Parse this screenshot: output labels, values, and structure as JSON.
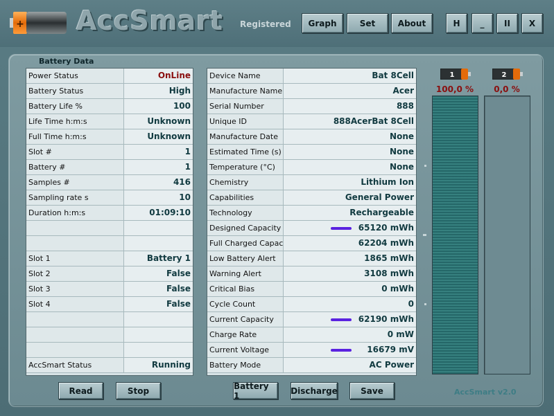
{
  "app": {
    "title": "AccSmart",
    "registered": "Registered",
    "version": "AccSmart v2.0",
    "logo_symbol": "+"
  },
  "header_buttons": {
    "graph": "Graph",
    "set": "Set",
    "about": "About",
    "h": "H",
    "minimize": "_",
    "pause": "II",
    "close": "X"
  },
  "section_label": "Battery Data",
  "left_table": [
    {
      "label": "Power Status",
      "value": "OnLine",
      "red": true
    },
    {
      "label": "Battery Status",
      "value": "High"
    },
    {
      "label": "Battery Life %",
      "value": "100"
    },
    {
      "label": "Life Time h:m:s",
      "value": "Unknown"
    },
    {
      "label": "Full Time h:m:s",
      "value": "Unknown"
    },
    {
      "label": "Slot #",
      "value": "1"
    },
    {
      "label": "Battery #",
      "value": "1"
    },
    {
      "label": "Samples #",
      "value": "416"
    },
    {
      "label": "Sampling rate s",
      "value": "10"
    },
    {
      "label": "Duration h:m:s",
      "value": "01:09:10"
    },
    {
      "label": "",
      "value": ""
    },
    {
      "label": "",
      "value": ""
    },
    {
      "label": "Slot 1",
      "value": "Battery 1"
    },
    {
      "label": "Slot 2",
      "value": "False"
    },
    {
      "label": "Slot 3",
      "value": "False"
    },
    {
      "label": "Slot 4",
      "value": "False"
    },
    {
      "label": "",
      "value": ""
    },
    {
      "label": "",
      "value": ""
    },
    {
      "label": "",
      "value": ""
    },
    {
      "label": "AccSmart Status",
      "value": "Running"
    }
  ],
  "right_table": [
    {
      "label": "Device Name",
      "value": "Bat 8Cell"
    },
    {
      "label": "Manufacture Name",
      "value": "Acer"
    },
    {
      "label": "Serial Number",
      "value": "888"
    },
    {
      "label": "Unique ID",
      "value": "888AcerBat 8Cell"
    },
    {
      "label": "Manufacture Date",
      "value": "None"
    },
    {
      "label": "Estimated Time (s)",
      "value": "None"
    },
    {
      "label": "Temperature (°C)",
      "value": "None"
    },
    {
      "label": "Chemistry",
      "value": "Lithium Ion"
    },
    {
      "label": "Capabilities",
      "value": "General Power"
    },
    {
      "label": "Technology",
      "value": "Rechargeable"
    },
    {
      "label": "Designed Capacity",
      "value": "65120 mWh",
      "mark": true
    },
    {
      "label": "Full Charged Capacity",
      "value": "62204 mWh"
    },
    {
      "label": "Low Battery Alert",
      "value": "1865 mWh"
    },
    {
      "label": "Warning Alert",
      "value": "3108 mWh"
    },
    {
      "label": "Critical Bias",
      "value": "0 mWh"
    },
    {
      "label": "Cycle Count",
      "value": "0"
    },
    {
      "label": "Current Capacity",
      "value": "62190 mWh",
      "mark": true
    },
    {
      "label": "Charge Rate",
      "value": "0 mW"
    },
    {
      "label": "Current Voltage",
      "value": "16679 mV",
      "mark": true
    },
    {
      "label": "Battery Mode",
      "value": "AC Power"
    }
  ],
  "bottom_buttons": {
    "read": "Read",
    "stop": "Stop",
    "battery": "Battery 1",
    "discharge": "Discharge",
    "save": "Save"
  },
  "gauges": [
    {
      "number": "1",
      "percent_label": "100,0 %",
      "fill_fraction": 1.0
    },
    {
      "number": "2",
      "percent_label": "0,0 %",
      "fill_fraction": 0.0
    }
  ],
  "colors": {
    "value_text": "#113a40",
    "alert_text": "#8a0f0f",
    "mark": "#5a22e0",
    "gauge_fill": "#1c5b5d"
  }
}
